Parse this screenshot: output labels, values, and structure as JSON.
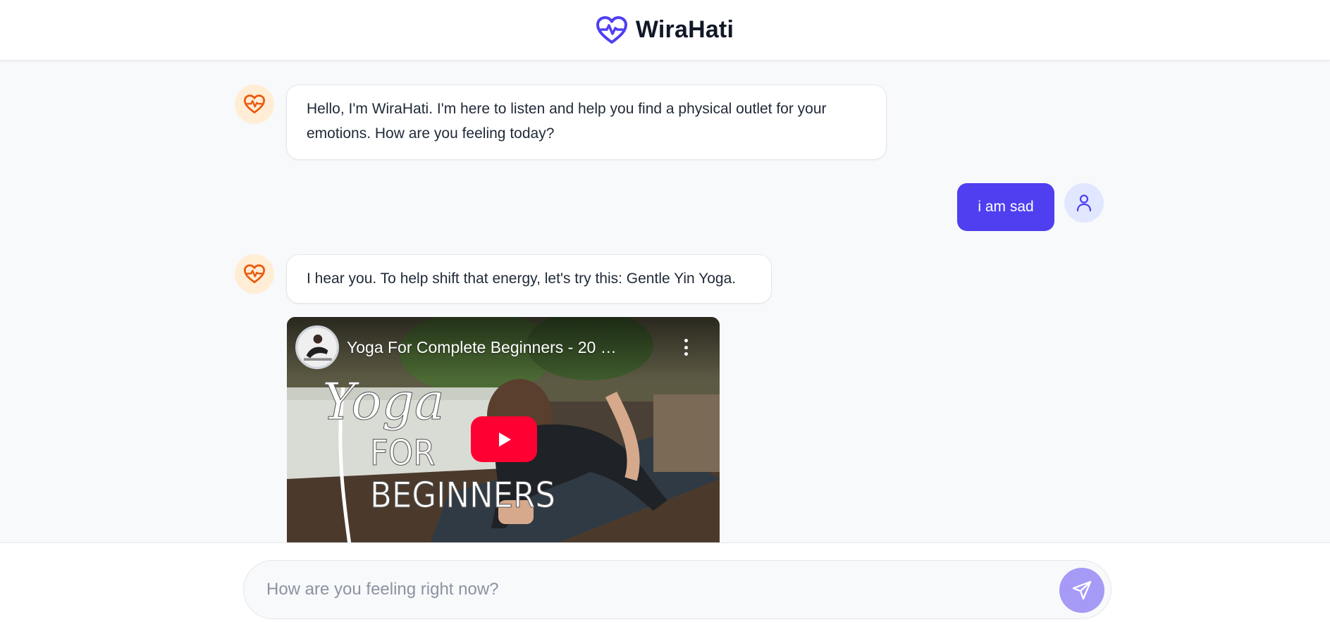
{
  "header": {
    "brand_name": "WiraHati",
    "logo_icon": "heart-pulse-icon",
    "brand_color": "#4f3ff0"
  },
  "messages": [
    {
      "role": "bot",
      "text": "Hello, I'm WiraHati. I'm here to listen and help you find a physical outlet for your emotions. How are you feeling today?"
    },
    {
      "role": "user",
      "text": "i am sad"
    },
    {
      "role": "bot",
      "text": "I hear you. To help shift that energy, let's try this: Gentle Yin Yoga."
    }
  ],
  "video": {
    "title": "Yoga For Complete Beginners - 20 Min...",
    "thumbnail_art_text": [
      "Yoga",
      "FOR",
      "BEGINNERS"
    ],
    "play_icon": "play-icon",
    "menu_icon": "more-vertical-icon"
  },
  "composer": {
    "placeholder": "How are you feeling right now?",
    "value": "",
    "send_icon": "send-icon"
  },
  "colors": {
    "accent": "#4f3ff0",
    "bot_avatar_bg": "#ffedd5",
    "bot_icon": "#ea580c",
    "user_avatar_bg": "#e0e7ff",
    "send_button": "#a59af5",
    "play_button": "#ff0033"
  }
}
